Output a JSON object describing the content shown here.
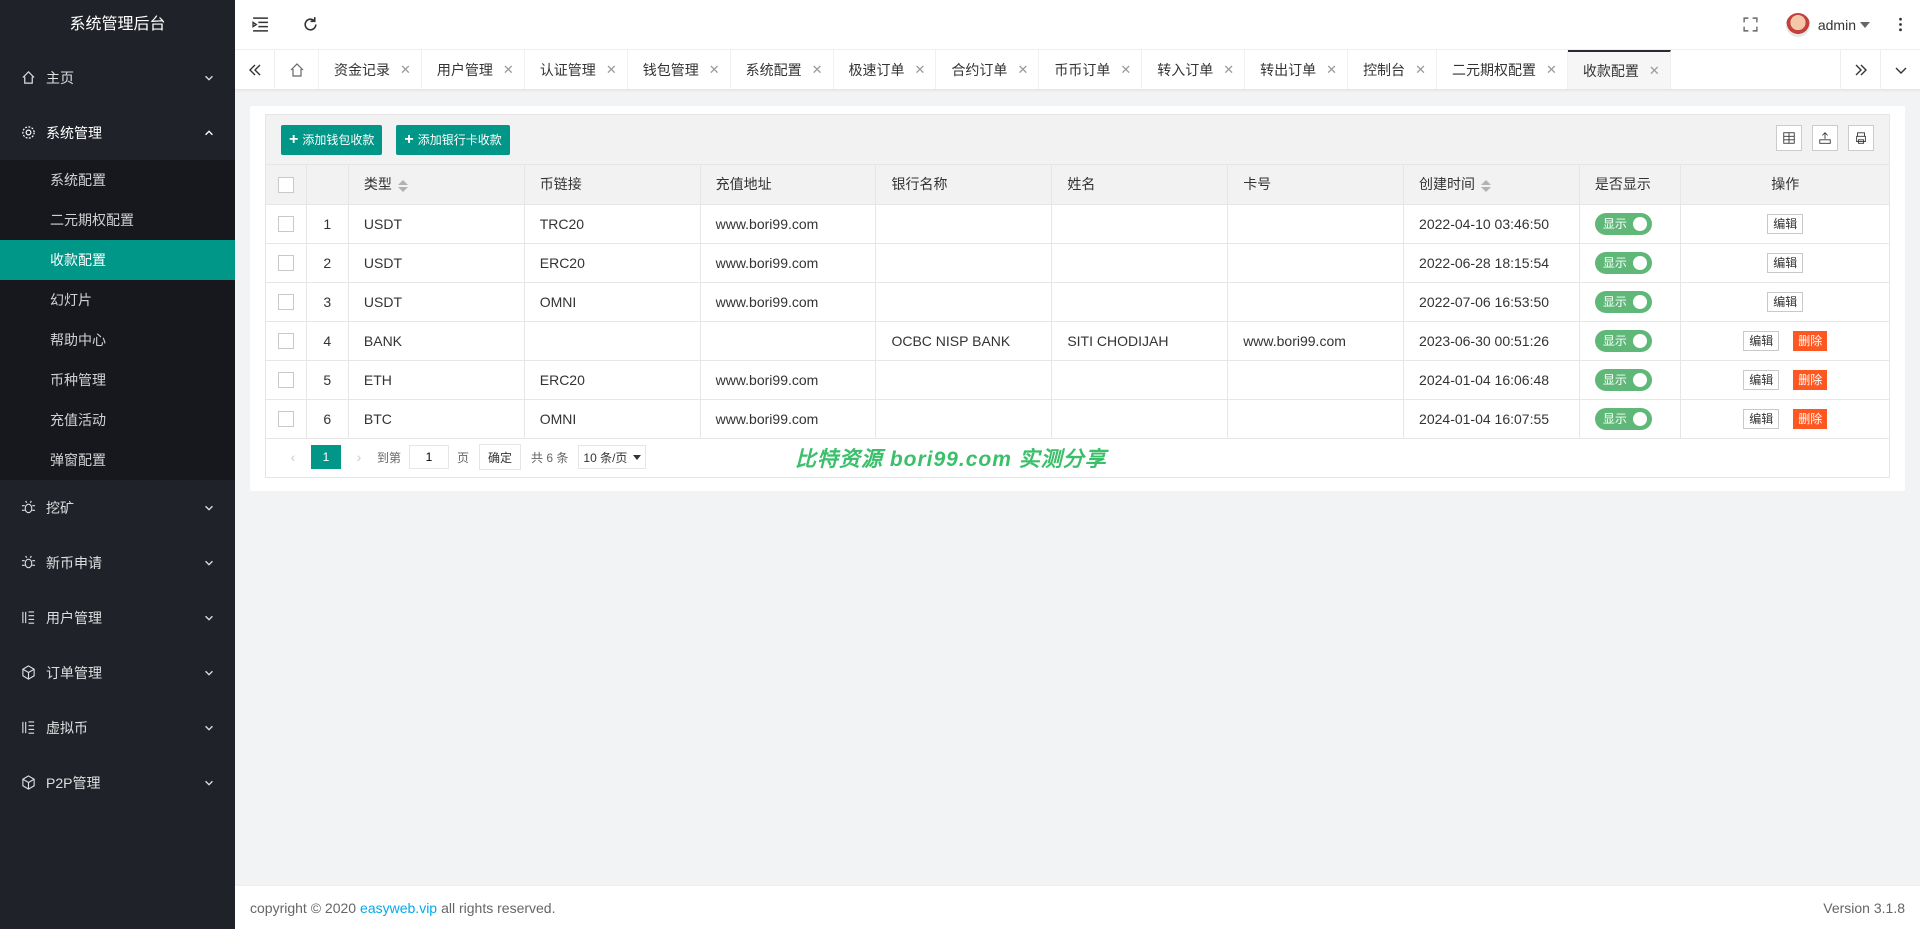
{
  "app": {
    "title": "系统管理后台"
  },
  "sidebar": {
    "items": [
      {
        "label": "主页",
        "icon": "home-icon"
      },
      {
        "label": "系统管理",
        "icon": "gear-icon",
        "open": true,
        "children": [
          "系统配置",
          "二元期权配置",
          "收款配置",
          "幻灯片",
          "帮助中心",
          "币种管理",
          "充值活动",
          "弹窗配置"
        ],
        "active_child": "收款配置"
      },
      {
        "label": "挖矿",
        "icon": "bug-icon"
      },
      {
        "label": "新币申请",
        "icon": "bug-icon"
      },
      {
        "label": "用户管理",
        "icon": "list-icon"
      },
      {
        "label": "订单管理",
        "icon": "cube-icon"
      },
      {
        "label": "虚拟币",
        "icon": "list-icon"
      },
      {
        "label": "P2P管理",
        "icon": "cube-icon"
      }
    ]
  },
  "header": {
    "user": "admin"
  },
  "tabs": {
    "items": [
      "资金记录",
      "用户管理",
      "认证管理",
      "钱包管理",
      "系统配置",
      "极速订单",
      "合约订单",
      "币币订单",
      "转入订单",
      "转出订单",
      "控制台",
      "二元期权配置",
      "收款配置"
    ],
    "active": "收款配置",
    "close_glyph": "✕"
  },
  "toolbar": {
    "add_wallet": "添加钱包收款",
    "add_bank": "添加银行卡收款"
  },
  "table": {
    "columns": [
      "类型",
      "币链接",
      "充值地址",
      "银行名称",
      "姓名",
      "卡号",
      "创建时间",
      "是否显示",
      "操作"
    ],
    "rows": [
      {
        "no": "1",
        "type": "USDT",
        "chain": "TRC20",
        "address": "www.bori99.com",
        "bank": "",
        "name": "",
        "card": "",
        "created": "2022-04-10 03:46:50",
        "show": "显示",
        "actions": [
          "编辑"
        ]
      },
      {
        "no": "2",
        "type": "USDT",
        "chain": "ERC20",
        "address": "www.bori99.com",
        "bank": "",
        "name": "",
        "card": "",
        "created": "2022-06-28 18:15:54",
        "show": "显示",
        "actions": [
          "编辑"
        ]
      },
      {
        "no": "3",
        "type": "USDT",
        "chain": "OMNI",
        "address": "www.bori99.com",
        "bank": "",
        "name": "",
        "card": "",
        "created": "2022-07-06 16:53:50",
        "show": "显示",
        "actions": [
          "编辑"
        ]
      },
      {
        "no": "4",
        "type": "BANK",
        "chain": "",
        "address": "",
        "bank": "OCBC NISP BANK",
        "name": "SITI CHODIJAH",
        "card": "www.bori99.com",
        "created": "2023-06-30 00:51:26",
        "show": "显示",
        "actions": [
          "编辑",
          "删除"
        ]
      },
      {
        "no": "5",
        "type": "ETH",
        "chain": "ERC20",
        "address": "www.bori99.com",
        "bank": "",
        "name": "",
        "card": "",
        "created": "2024-01-04 16:06:48",
        "show": "显示",
        "actions": [
          "编辑",
          "删除"
        ]
      },
      {
        "no": "6",
        "type": "BTC",
        "chain": "OMNI",
        "address": "www.bori99.com",
        "bank": "",
        "name": "",
        "card": "",
        "created": "2024-01-04 16:07:55",
        "show": "显示",
        "actions": [
          "编辑",
          "删除"
        ]
      }
    ]
  },
  "pager": {
    "current": "1",
    "goto_label": "到第",
    "goto_value": "1",
    "page_unit": "页",
    "confirm": "确定",
    "total": "共 6 条",
    "page_size": "10 条/页"
  },
  "watermark": "比特资源  bori99.com  实测分享",
  "footer": {
    "copyright_prefix": "copyright © 2020 ",
    "link": "easyweb.vip",
    "copyright_suffix": " all rights reserved.",
    "version": "Version 3.1.8"
  },
  "colors": {
    "primary": "#009688",
    "danger": "#ff5722",
    "switch_on": "#5fb878",
    "sidebar_bg": "#20222a"
  }
}
